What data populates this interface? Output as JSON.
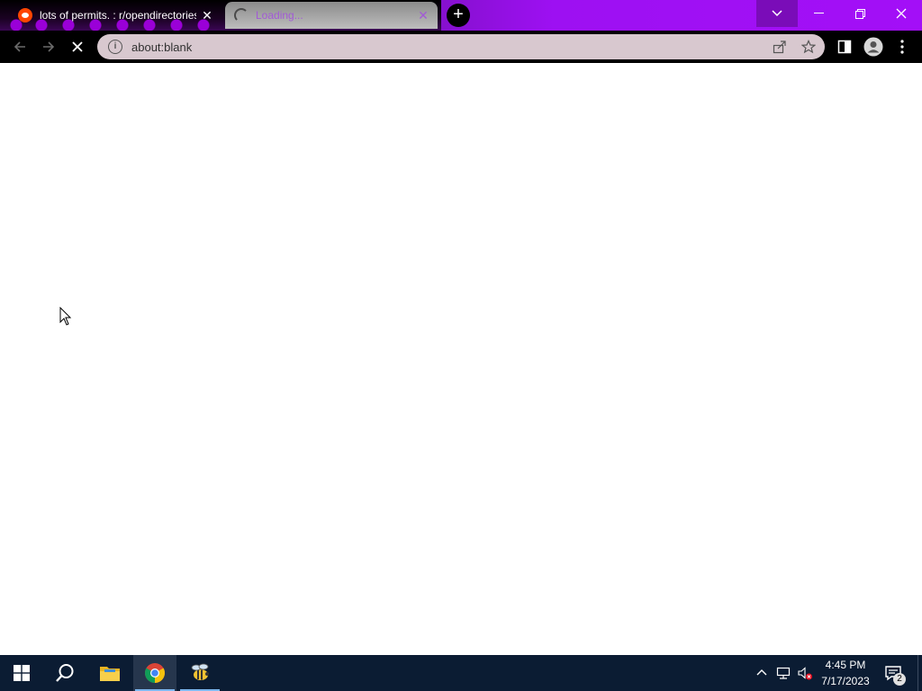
{
  "browser": {
    "tabs": [
      {
        "title": "lots of permits. : r/opendirectories",
        "favicon": "reddit-icon",
        "state": "loaded"
      },
      {
        "title": "Loading...",
        "favicon": "loading-spinner-icon",
        "state": "loading"
      }
    ],
    "new_tab_symbol": "+",
    "address": "about:blank",
    "colors": {
      "tabbar_accent": "#a30ff7",
      "omnibox_bg": "#d8c8cf",
      "toolbar_bg": "#000000"
    }
  },
  "taskbar": {
    "apps": [
      {
        "name": "start",
        "icon": "windows-start-icon"
      },
      {
        "name": "search",
        "icon": "search-icon"
      },
      {
        "name": "file-explorer",
        "icon": "folder-icon"
      },
      {
        "name": "chrome",
        "icon": "chrome-icon",
        "active": true
      },
      {
        "name": "app",
        "icon": "bee-app-icon",
        "running": true
      }
    ],
    "clock": {
      "time": "4:45 PM",
      "date": "7/17/2023"
    },
    "notification_count": "2"
  }
}
